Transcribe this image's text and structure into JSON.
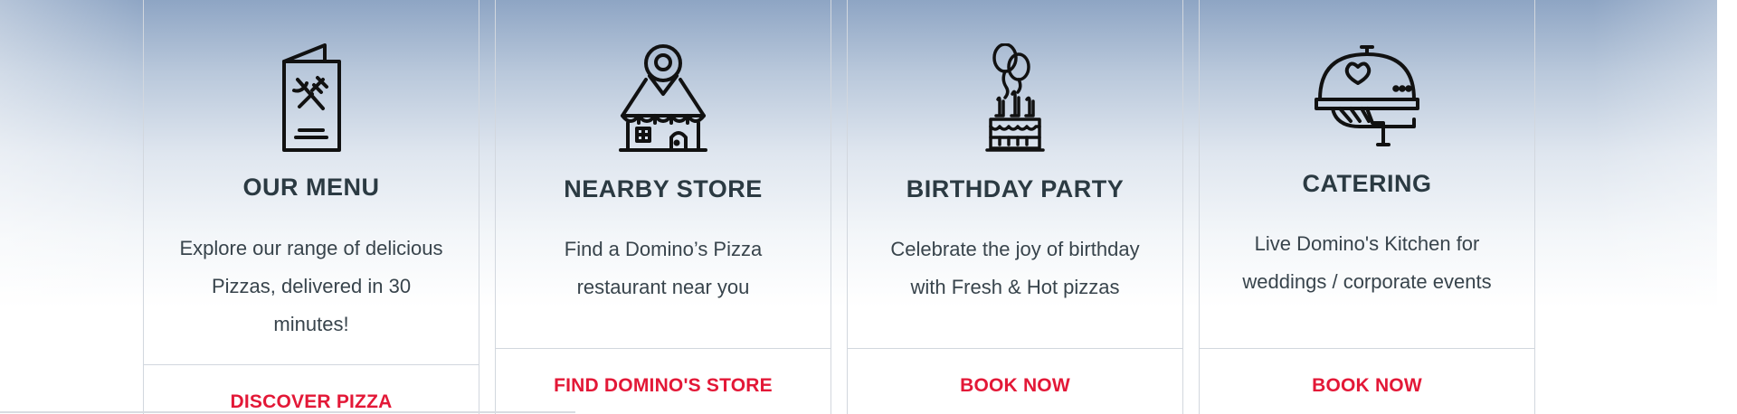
{
  "cards": [
    {
      "icon": "menu-card-icon",
      "title": "OUR MENU",
      "desc_lines": [
        "Explore our range of delicious",
        "Pizzas, delivered in 30",
        "minutes!"
      ],
      "cta": "DISCOVER PIZZA"
    },
    {
      "icon": "store-location-icon",
      "title": "NEARBY STORE",
      "desc_lines": [
        "Find a Domino’s Pizza",
        "restaurant near you"
      ],
      "cta": "FIND DOMINO'S STORE"
    },
    {
      "icon": "birthday-cake-icon",
      "title": "BIRTHDAY PARTY",
      "desc_lines": [
        "Celebrate the joy of birthday",
        "with Fresh & Hot pizzas"
      ],
      "cta": "BOOK NOW"
    },
    {
      "icon": "catering-cloche-icon",
      "title": "CATERING",
      "desc_lines": [
        "Live Domino's Kitchen for",
        "weddings / corporate events"
      ],
      "cta": "BOOK NOW"
    }
  ],
  "colors": {
    "title": "#2b3a42",
    "text": "#38444c",
    "cta": "#e31837",
    "border": "#d2d7de"
  }
}
